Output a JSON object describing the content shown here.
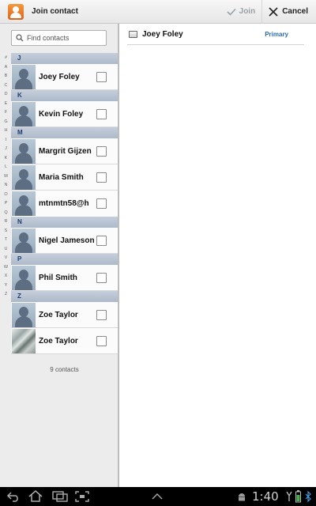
{
  "header": {
    "title": "Join contact",
    "join_label": "Join",
    "cancel_label": "Cancel"
  },
  "search": {
    "placeholder": "Find contacts"
  },
  "index_letters": [
    "#",
    "A",
    "B",
    "C",
    "D",
    "E",
    "F",
    "G",
    "H",
    "I",
    "J",
    "K",
    "L",
    "M",
    "N",
    "O",
    "P",
    "Q",
    "R",
    "S",
    "T",
    "U",
    "V",
    "W",
    "X",
    "Y",
    "Z"
  ],
  "sections": [
    {
      "letter": "J",
      "contacts": [
        {
          "name": "Joey Foley",
          "avatar": "default"
        }
      ]
    },
    {
      "letter": "K",
      "contacts": [
        {
          "name": "Kevin Foley",
          "avatar": "default"
        }
      ]
    },
    {
      "letter": "M",
      "contacts": [
        {
          "name": "Margrit Gijzen",
          "avatar": "default"
        },
        {
          "name": "Maria Smith",
          "avatar": "default"
        },
        {
          "name": "mtnmtn58@h",
          "avatar": "default"
        }
      ]
    },
    {
      "letter": "N",
      "contacts": [
        {
          "name": "Nigel Jameson",
          "avatar": "default"
        }
      ]
    },
    {
      "letter": "P",
      "contacts": [
        {
          "name": "Phil Smith",
          "avatar": "default"
        }
      ]
    },
    {
      "letter": "Z",
      "contacts": [
        {
          "name": "Zoe Taylor",
          "avatar": "default"
        },
        {
          "name": "Zoe Taylor",
          "avatar": "photo"
        }
      ]
    }
  ],
  "contact_count": "9 contacts",
  "selected": {
    "name": "Joey Foley",
    "tag": "Primary"
  },
  "status_bar": {
    "time": "1:40"
  },
  "colors": {
    "accent": "#2a6bb5",
    "section_header": "#b7c2d2",
    "app_icon": "#e8721f"
  }
}
